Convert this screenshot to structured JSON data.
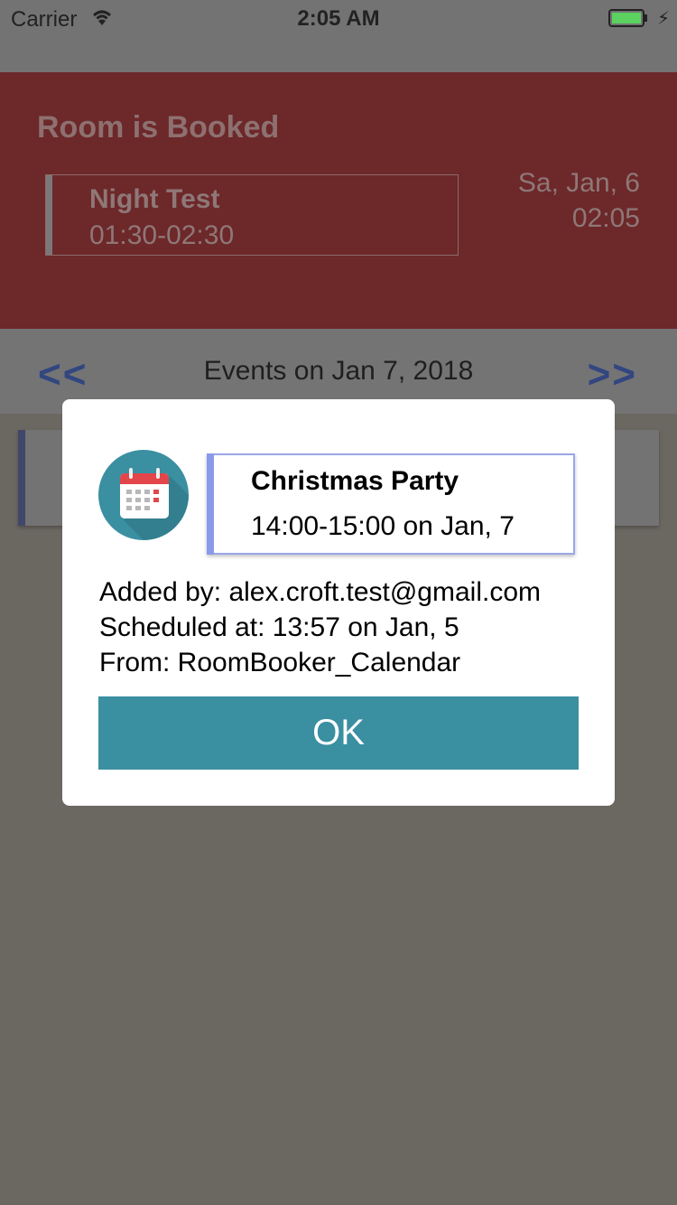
{
  "status_bar": {
    "carrier": "Carrier",
    "time": "2:05 AM"
  },
  "header": {
    "title": "Room is Booked",
    "current_event": {
      "title": "Night Test",
      "time": "01:30-02:30"
    },
    "clock": {
      "date": "Sa, Jan, 6",
      "time": "02:05"
    }
  },
  "nav": {
    "prev_label": "<<",
    "title": "Events on Jan 7, 2018",
    "next_label": ">>"
  },
  "modal": {
    "icon": "calendar-icon",
    "event_title": "Christmas Party",
    "event_time": "14:00-15:00 on Jan, 7",
    "added_by": "Added by: alex.croft.test@gmail.com",
    "scheduled_at": "Scheduled at: 13:57 on Jan, 5",
    "from": "From: RoomBooker_Calendar",
    "ok_label": "OK"
  },
  "colors": {
    "header_bg": "#6d282a",
    "accent_teal": "#3a8fa1",
    "card_accent": "#8a9ae8"
  }
}
